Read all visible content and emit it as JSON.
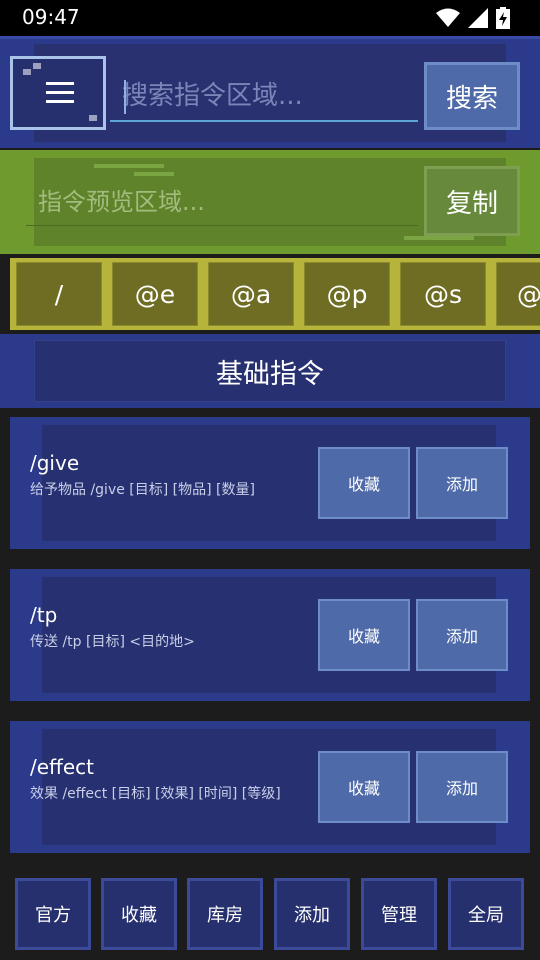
{
  "status_bar": {
    "time": "09:47",
    "icons": [
      "wifi-icon",
      "signal-icon",
      "battery-charging-icon"
    ]
  },
  "search": {
    "placeholder": "搜索指令区域...",
    "button_label": "搜索",
    "menu_icon": "hamburger-icon"
  },
  "preview": {
    "placeholder": "指令预览区域...",
    "copy_label": "复制"
  },
  "selectors": [
    "/",
    "@e",
    "@a",
    "@p",
    "@s",
    "@r"
  ],
  "category": {
    "title": "基础指令"
  },
  "commands": [
    {
      "name": "/give",
      "description": "给予物品 /give [目标] [物品] [数量]",
      "favorite_label": "收藏",
      "add_label": "添加"
    },
    {
      "name": "/tp",
      "description": "传送 /tp [目标] <目的地>",
      "favorite_label": "收藏",
      "add_label": "添加"
    },
    {
      "name": "/effect",
      "description": "效果 /effect [目标] [效果] [时间] [等级]",
      "favorite_label": "收藏",
      "add_label": "添加"
    }
  ],
  "bottom_nav": [
    "官方",
    "收藏",
    "库房",
    "添加",
    "管理",
    "全局"
  ],
  "colors": {
    "accent_blue": "#2b3a8a",
    "preview_green": "#6f9a2e",
    "selector_yellow": "#b6b43a",
    "input_underline": "#5ea6d8"
  }
}
